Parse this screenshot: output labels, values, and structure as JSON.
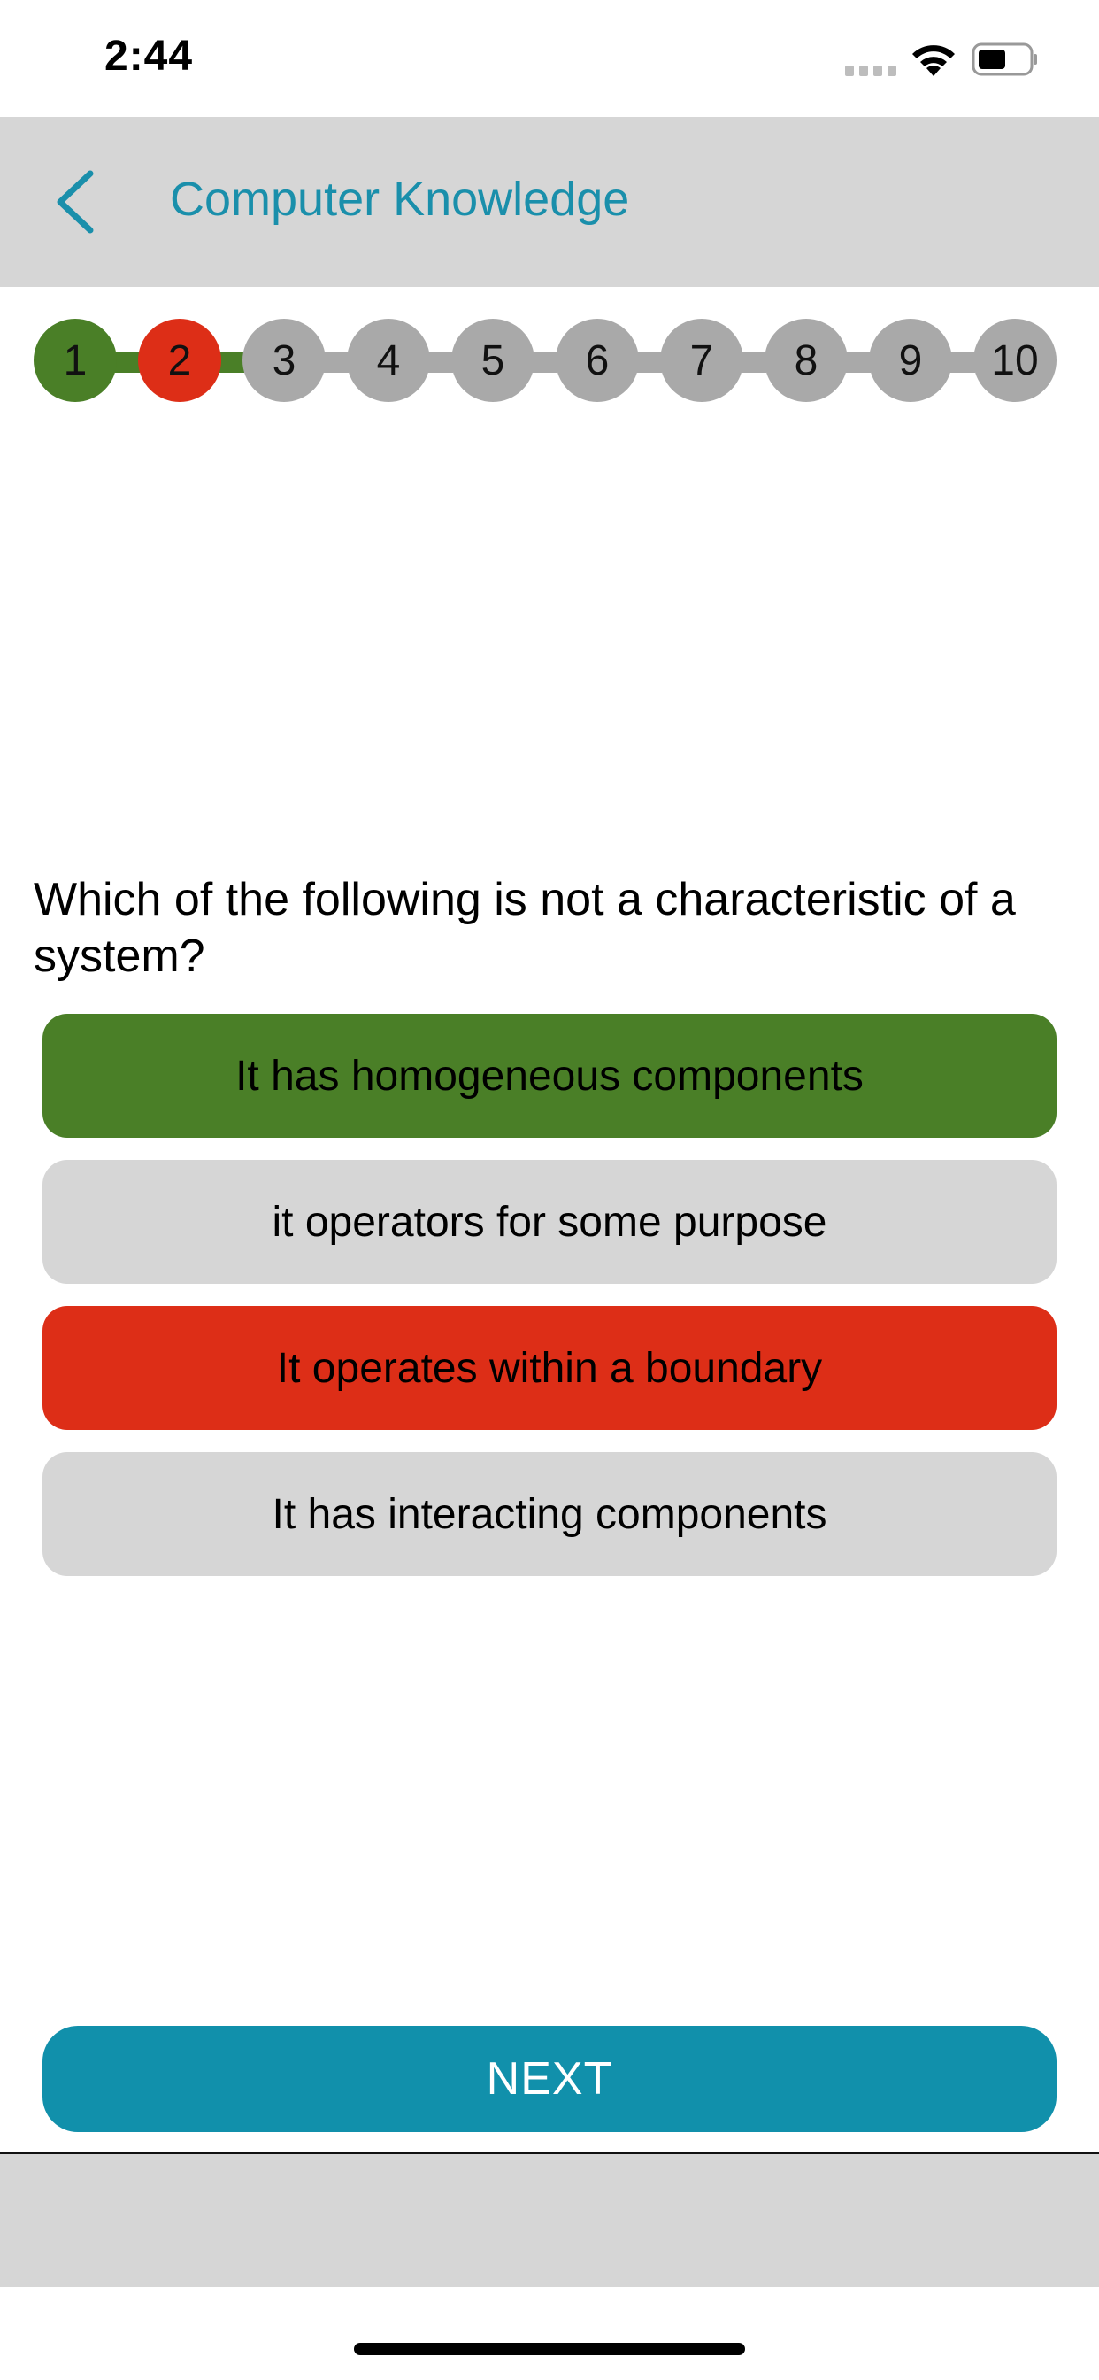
{
  "status_bar": {
    "time": "2:44"
  },
  "nav": {
    "title": "Computer Knowledge",
    "back_icon": "chevron-left-icon",
    "accent_color": "#1a8fab"
  },
  "progress": {
    "steps": [
      {
        "label": "1",
        "state": "correct"
      },
      {
        "label": "2",
        "state": "wrong"
      },
      {
        "label": "3",
        "state": "pending"
      },
      {
        "label": "4",
        "state": "pending"
      },
      {
        "label": "5",
        "state": "pending"
      },
      {
        "label": "6",
        "state": "pending"
      },
      {
        "label": "7",
        "state": "pending"
      },
      {
        "label": "8",
        "state": "pending"
      },
      {
        "label": "9",
        "state": "pending"
      },
      {
        "label": "10",
        "state": "pending"
      }
    ],
    "colors": {
      "correct": "#4a7f27",
      "wrong": "#dd2e17",
      "pending": "#a9a9a9"
    }
  },
  "question": {
    "text": "Which of the following is not a characteristic of a system?"
  },
  "answers": [
    {
      "label": "It has homogeneous components",
      "state": "correct"
    },
    {
      "label": "it operators for some purpose",
      "state": "neutral"
    },
    {
      "label": "It operates within a boundary",
      "state": "wrong"
    },
    {
      "label": "It has interacting components",
      "state": "neutral"
    }
  ],
  "next_button": {
    "label": "NEXT",
    "color": "#1190ab"
  }
}
